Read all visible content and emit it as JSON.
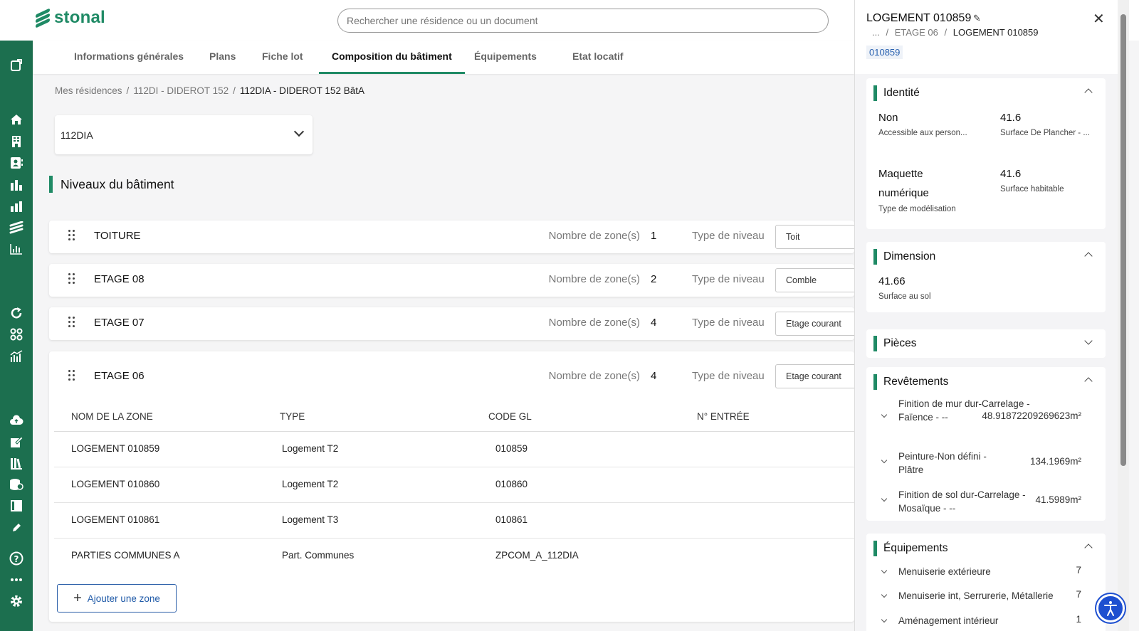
{
  "app": {
    "logo_text": "stonal",
    "brand_color": "#1f8a65"
  },
  "search": {
    "placeholder": "Rechercher une résidence ou un document"
  },
  "sidebar": {
    "icons": [
      "exit-icon",
      "home-icon",
      "building-icon",
      "contact-card-icon",
      "bar-chart-icon",
      "bar-chart-alt-icon",
      "stonal-icon",
      "analytics-icon",
      "refresh-icon",
      "grid-icon",
      "trend-chart-icon",
      "cloud-upload-icon",
      "edit-document-icon",
      "library-icon",
      "database-icon",
      "layout-icon",
      "pen-icon",
      "help-icon",
      "more-icon",
      "settings-icon"
    ]
  },
  "tabs": [
    {
      "label": "Informations générales"
    },
    {
      "label": "Plans"
    },
    {
      "label": "Fiche lot"
    },
    {
      "label": "Composition du bâtiment",
      "active": true
    },
    {
      "label": "Équipements"
    },
    {
      "label": "Etat locatif"
    }
  ],
  "breadcrumb": {
    "items": [
      "Mes résidences",
      "112DI - DIDEROT 152"
    ],
    "current": "112DIA - DIDEROT 152 BâtA"
  },
  "building_select": {
    "value": "112DIA"
  },
  "levels_section": {
    "title": "Niveaux du bâtiment"
  },
  "levels": [
    {
      "name": "TOITURE",
      "zones_label": "Nombre de zone(s)",
      "zones": "1",
      "type_label": "Type de niveau",
      "type": "Toit"
    },
    {
      "name": "ETAGE 08",
      "zones_label": "Nombre de zone(s)",
      "zones": "2",
      "type_label": "Type de niveau",
      "type": "Comble"
    },
    {
      "name": "ETAGE 07",
      "zones_label": "Nombre de zone(s)",
      "zones": "4",
      "type_label": "Type de niveau",
      "type": "Etage courant"
    },
    {
      "name": "ETAGE 06",
      "zones_label": "Nombre de zone(s)",
      "zones": "4",
      "type_label": "Type de niveau",
      "type": "Etage courant"
    }
  ],
  "zone_table": {
    "headers": [
      "NOM DE LA ZONE",
      "TYPE",
      "CODE GL",
      "N° ENTRÉE"
    ],
    "rows": [
      [
        "LOGEMENT 010859",
        "Logement T2",
        "010859",
        ""
      ],
      [
        "LOGEMENT 010860",
        "Logement T2",
        "010860",
        ""
      ],
      [
        "LOGEMENT 010861",
        "Logement T3",
        "010861",
        ""
      ],
      [
        "PARTIES COMMUNES A",
        "Part. Communes",
        "ZPCOM_A_112DIA",
        ""
      ]
    ],
    "add_label": "Ajouter une zone"
  },
  "panel": {
    "title": "LOGEMENT 010859",
    "crumb_prefix": "...",
    "crumb_middle": "ETAGE 06",
    "crumb_current": "LOGEMENT 010859",
    "badge": "010859",
    "identite": {
      "title": "Identité",
      "items": [
        {
          "value": "Non",
          "label": "Accessible aux person..."
        },
        {
          "value": "41.6",
          "label": "Surface De Plancher - ..."
        },
        {
          "value": "Maquette numérique",
          "label": "Type de modélisation"
        },
        {
          "value": "41.6",
          "label": "Surface habitable"
        }
      ]
    },
    "dimension": {
      "title": "Dimension",
      "value": "41.66",
      "label": "Surface au sol"
    },
    "pieces": {
      "title": "Pièces"
    },
    "revetements": {
      "title": "Revêtements",
      "items": [
        {
          "label": "Finition de mur dur-Carrelage - Faïence - --",
          "value": "48.91872209269623m²"
        },
        {
          "label": "Peinture-Non défini - Plâtre",
          "value": "134.1969m²"
        },
        {
          "label": "Finition de sol dur-Carrelage - Mosaïque - --",
          "value": "41.5989m²"
        }
      ]
    },
    "equipements": {
      "title": "Équipements",
      "items": [
        {
          "label": "Menuiserie extérieure",
          "value": "7"
        },
        {
          "label": "Menuiserie int, Serrurerie, Métallerie",
          "value": "7"
        },
        {
          "label": "Aménagement intérieur",
          "value": "1"
        }
      ]
    }
  }
}
